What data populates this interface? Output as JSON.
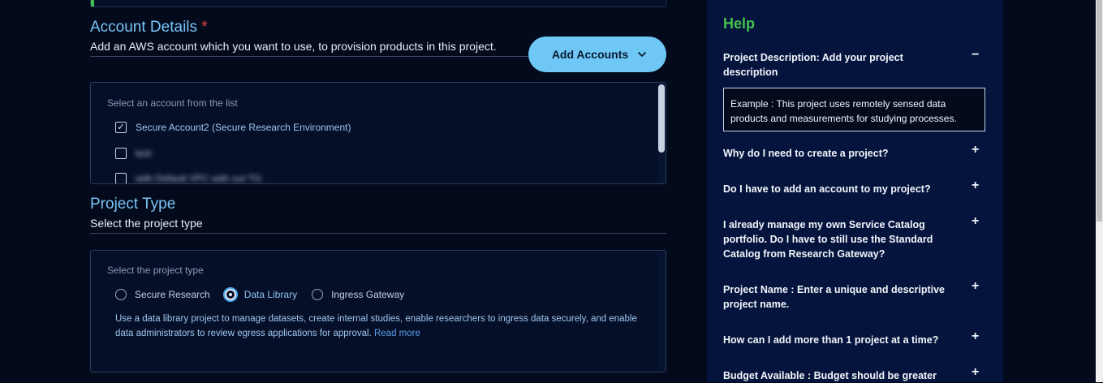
{
  "account_details": {
    "title": "Account Details",
    "required_mark": "*",
    "subtitle": "Add an AWS account which you want to use, to provision products in this project.",
    "add_button_label": "Add Accounts",
    "list_label": "Select an account from the list",
    "accounts": [
      {
        "label": "Secure Account2 (Secure Research Environment)",
        "checked": true,
        "blurred": false
      },
      {
        "label": "test",
        "checked": false,
        "blurred": true
      },
      {
        "label": "with Default VPC with out TG",
        "checked": false,
        "blurred": true
      }
    ]
  },
  "project_type": {
    "title": "Project Type",
    "subtitle": "Select the project type",
    "panel_label": "Select the project type",
    "options": [
      {
        "label": "Secure Research",
        "selected": false
      },
      {
        "label": "Data Library",
        "selected": true
      },
      {
        "label": "Ingress Gateway",
        "selected": false
      }
    ],
    "description": "Use a data library project to manage datasets, create internal studies, enable researchers to ingress data securely, and enable data administrators to review egress applications for approval.",
    "read_more": "Read more"
  },
  "help": {
    "title": "Help",
    "items": [
      {
        "question": "Project Description: Add your project description",
        "expanded": true,
        "answer": "Example : This project uses remotely sensed data products and measurements for studying processes."
      },
      {
        "question": "Why do I need to create a project?",
        "expanded": false
      },
      {
        "question": "Do I have to add an account to my project?",
        "expanded": false
      },
      {
        "question": "I already manage my own Service Catalog portfolio. Do I have to still use the Standard Catalog from Research Gateway?",
        "expanded": false
      },
      {
        "question": "Project Name : Enter a unique and descriptive project name.",
        "expanded": false
      },
      {
        "question": "How can I add more than 1 project at a time?",
        "expanded": false
      },
      {
        "question": "Budget Available : Budget should be greater",
        "expanded": false
      }
    ],
    "collapse_sign": "−",
    "expand_sign": "+"
  },
  "colors": {
    "background": "#020a1c",
    "accent": "#6fc7f5",
    "help_background": "#05143d",
    "help_title": "#45c24f",
    "required": "#e0473e"
  }
}
